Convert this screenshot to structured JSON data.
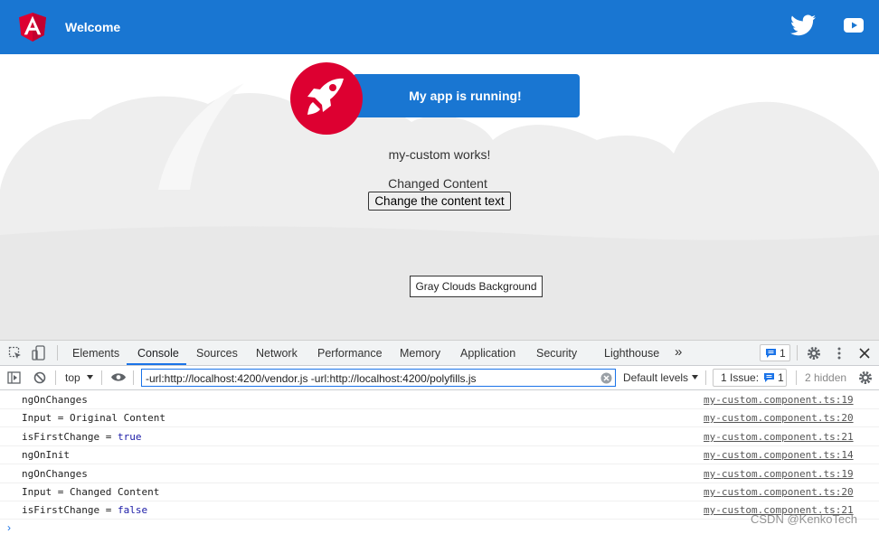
{
  "header": {
    "title": "Welcome",
    "brand_color": "#1976d2"
  },
  "main": {
    "banner": "My app is running!",
    "custom_text": "my-custom works!",
    "content_text": "Changed Content",
    "change_button": "Change the content text",
    "bg_label": "Gray Clouds Background"
  },
  "devtools": {
    "tabs": [
      {
        "label": "Elements"
      },
      {
        "label": "Console"
      },
      {
        "label": "Sources"
      },
      {
        "label": "Network"
      },
      {
        "label": "Performance"
      },
      {
        "label": "Memory"
      },
      {
        "label": "Application"
      },
      {
        "label": "Security"
      },
      {
        "label": "Lighthouse"
      }
    ],
    "more_tabs": "»",
    "message_count": "1",
    "toolbar": {
      "context": "top",
      "filter_value": "-url:http://localhost:4200/vendor.js -url:http://localhost:4200/polyfills.js",
      "levels": "Default levels",
      "issues_label": "1 Issue:",
      "issues_count": "1",
      "hidden": "2 hidden"
    },
    "console_rows": [
      {
        "text": "ngOnChanges",
        "source": "my-custom.component.ts:19"
      },
      {
        "text": "Input = Original Content",
        "source": "my-custom.component.ts:20"
      },
      {
        "text": "isFirstChange = ",
        "value": "true",
        "source": "my-custom.component.ts:21"
      },
      {
        "text": "ngOnInit",
        "source": "my-custom.component.ts:14"
      },
      {
        "text": "ngOnChanges",
        "source": "my-custom.component.ts:19"
      },
      {
        "text": "Input = Changed Content",
        "source": "my-custom.component.ts:20"
      },
      {
        "text": "isFirstChange = ",
        "value": "false",
        "source": "my-custom.component.ts:21"
      }
    ],
    "prompt": "›"
  },
  "watermark": "CSDN @KenkoTech"
}
